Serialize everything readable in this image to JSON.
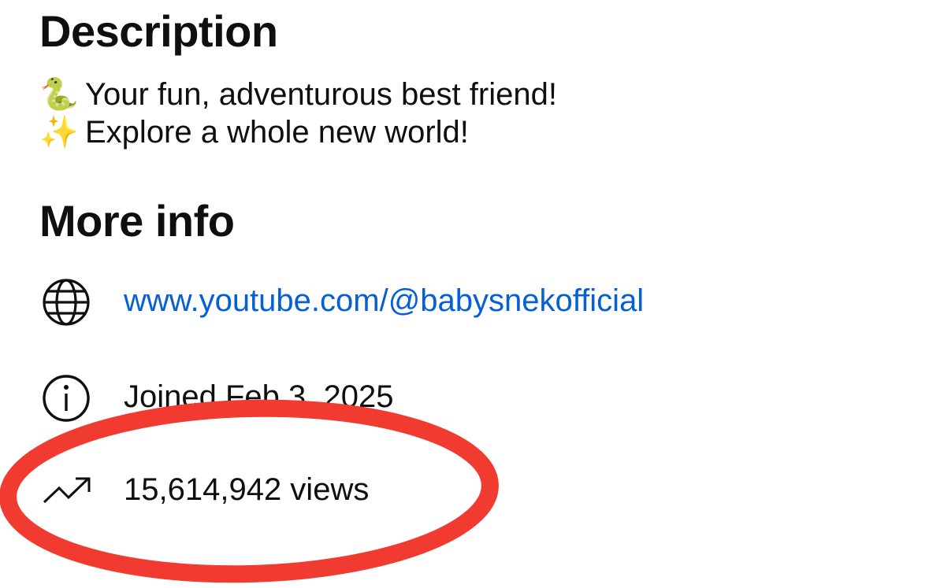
{
  "description": {
    "heading": "Description",
    "lines": [
      {
        "emoji": "🐍",
        "text": "Your fun, adventurous best friend!"
      },
      {
        "emoji": "✨",
        "text": "Explore a whole new world!"
      }
    ]
  },
  "more_info": {
    "heading": "More info",
    "link": {
      "icon": "globe-icon",
      "text": "www.youtube.com/@babysnekofficial"
    },
    "joined": {
      "icon": "info-icon",
      "text": "Joined Feb 3, 2025"
    },
    "views": {
      "icon": "trending-up-icon",
      "text": "15,614,942 views"
    }
  },
  "colors": {
    "link": "#065fd4",
    "text": "#0f0f0f",
    "annotation": "#f23b30"
  }
}
